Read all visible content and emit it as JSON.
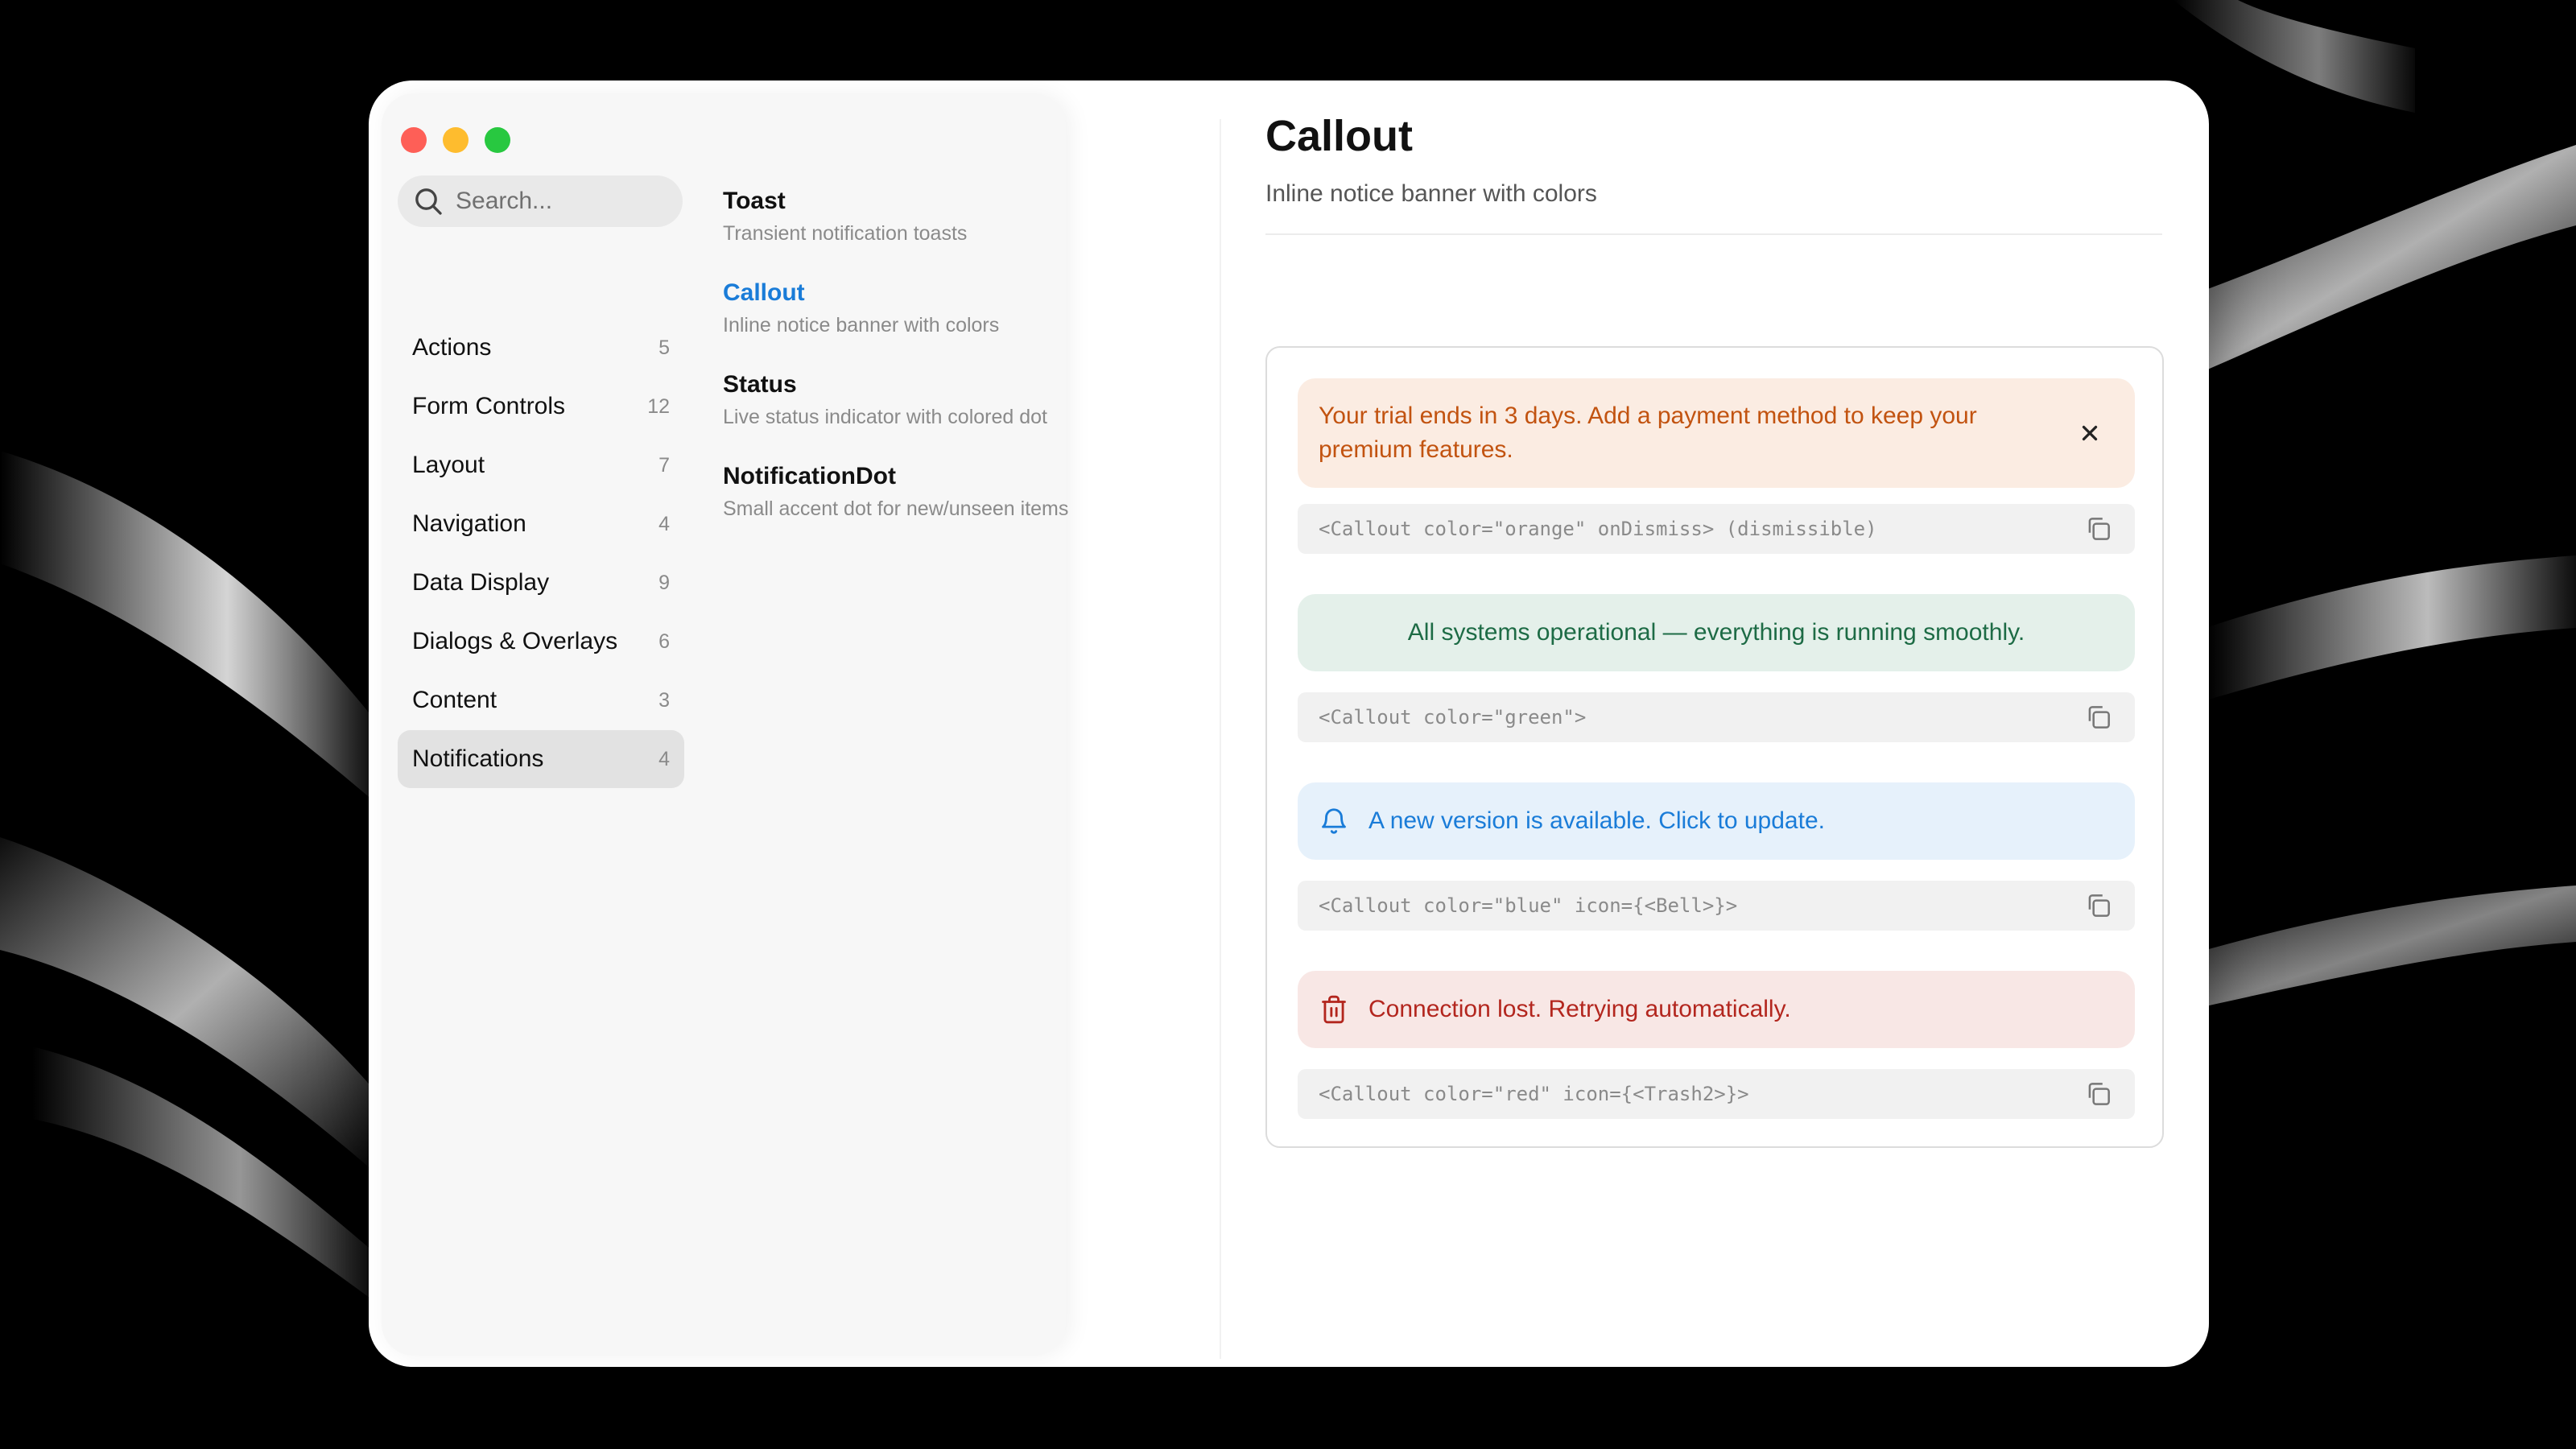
{
  "search": {
    "placeholder": "Search..."
  },
  "sidebar": {
    "categories": [
      {
        "label": "Actions",
        "count": "5"
      },
      {
        "label": "Form Controls",
        "count": "12"
      },
      {
        "label": "Layout",
        "count": "7"
      },
      {
        "label": "Navigation",
        "count": "4"
      },
      {
        "label": "Data Display",
        "count": "9"
      },
      {
        "label": "Dialogs & Overlays",
        "count": "6"
      },
      {
        "label": "Content",
        "count": "3"
      },
      {
        "label": "Notifications",
        "count": "4"
      }
    ],
    "active_category": "Notifications"
  },
  "components": [
    {
      "title": "Toast",
      "description": "Transient notification toasts"
    },
    {
      "title": "Callout",
      "description": "Inline notice banner with colors"
    },
    {
      "title": "Status",
      "description": "Live status indicator with colored dot"
    },
    {
      "title": "NotificationDot",
      "description": "Small accent dot for new/unseen items"
    }
  ],
  "active_component": "Callout",
  "detail": {
    "title": "Callout",
    "subtitle": "Inline notice banner with colors",
    "examples": [
      {
        "color": "orange",
        "message": "Your trial ends in 3 days. Add a payment method to keep your premium features.",
        "icon": "close-icon",
        "code": "<Callout color=\"orange\" onDismiss> (dismissible)"
      },
      {
        "color": "green",
        "message": "All systems operational — everything is running smoothly.",
        "icon": "",
        "code": "<Callout color=\"green\">"
      },
      {
        "color": "blue",
        "message": "A new version is available. Click to update.",
        "icon": "bell-icon",
        "code": "<Callout color=\"blue\" icon={<Bell>}>"
      },
      {
        "color": "red",
        "message": "Connection lost. Retrying automatically.",
        "icon": "trash-icon",
        "code": "<Callout color=\"red\" icon={<Trash2>}>"
      }
    ]
  },
  "colors": {
    "accent_blue": "#1a7cd8",
    "orange_text": "#c25310",
    "orange_bg": "#fbece2",
    "green_text": "#1d6b45",
    "green_bg": "#e4f0ea",
    "blue_bg": "#e6f1fb",
    "red_text": "#b3261e",
    "red_bg": "#f8e7e5"
  }
}
